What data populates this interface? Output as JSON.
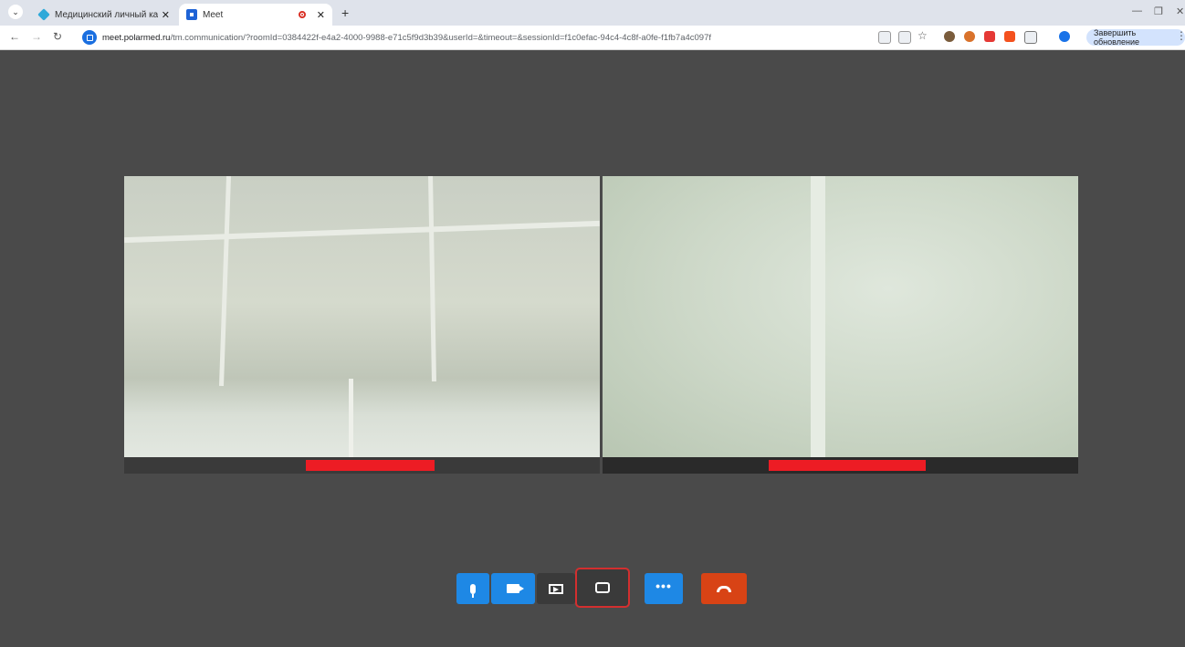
{
  "browser": {
    "tabs": [
      {
        "title": "Медицинский личный кабине",
        "active": false
      },
      {
        "title": "Meet",
        "active": true
      }
    ],
    "new_tab": "+",
    "url_host": "meet.polarmed.ru",
    "url_rest": "/tm.communication/?roomId=0384422f-e4a2-4000-9988-e71c5f9d3b39&userId=&timeout=&sessionId=f1c0efac-94c4-4c8f-a0fe-f1fb7a4c097f",
    "update_button": "Завершить обновление"
  },
  "meeting": {
    "participants": [
      {
        "audio_level": 0.27
      },
      {
        "audio_level": 0.33
      }
    ],
    "controls": [
      "microphone",
      "camera",
      "screen-share",
      "chat",
      "more",
      "hang-up"
    ]
  },
  "colors": {
    "stage_bg": "#4a4a4a",
    "control_blue": "#1e88e5",
    "hangup_red": "#d84315",
    "audio_level": "#ed1c24",
    "highlight": "#d32f2f"
  }
}
